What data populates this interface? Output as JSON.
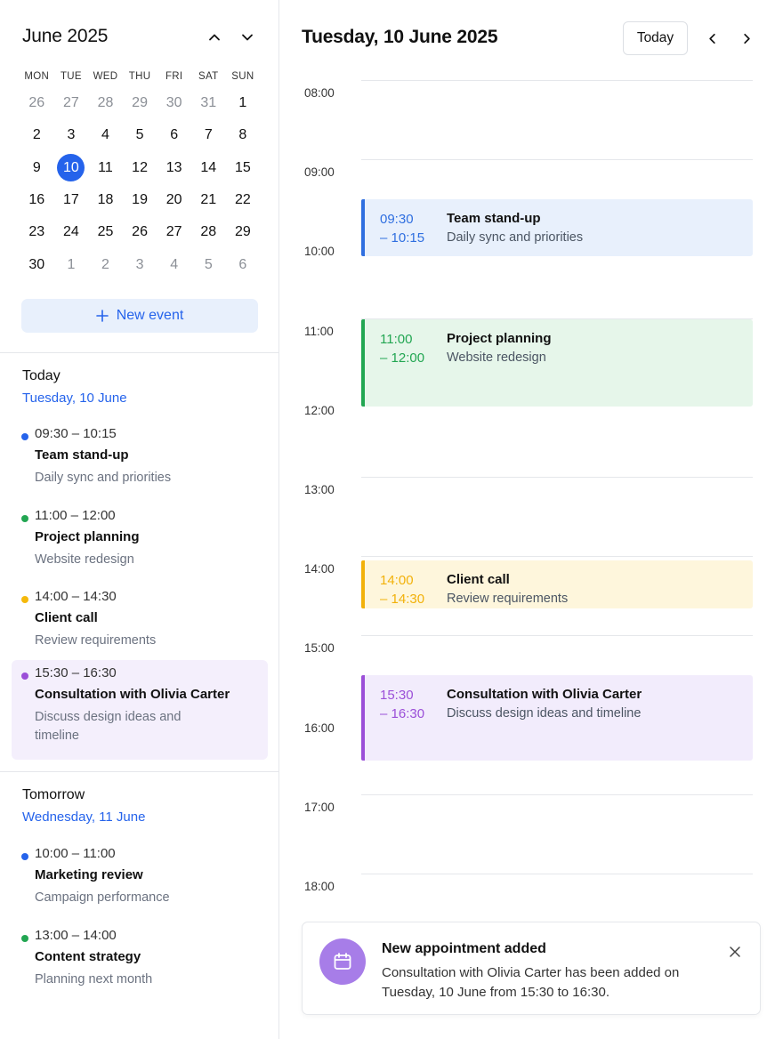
{
  "calendar": {
    "month_title": "June 2025",
    "weekdays": [
      "MON",
      "TUE",
      "WED",
      "THU",
      "FRI",
      "SAT",
      "SUN"
    ],
    "weeks": [
      [
        {
          "d": "26",
          "m": true
        },
        {
          "d": "27",
          "m": true
        },
        {
          "d": "28",
          "m": true
        },
        {
          "d": "29",
          "m": true
        },
        {
          "d": "30",
          "m": true
        },
        {
          "d": "31",
          "m": true
        },
        {
          "d": "1"
        }
      ],
      [
        {
          "d": "2"
        },
        {
          "d": "3"
        },
        {
          "d": "4"
        },
        {
          "d": "5"
        },
        {
          "d": "6"
        },
        {
          "d": "7"
        },
        {
          "d": "8"
        }
      ],
      [
        {
          "d": "9"
        },
        {
          "d": "10",
          "sel": true
        },
        {
          "d": "11"
        },
        {
          "d": "12"
        },
        {
          "d": "13"
        },
        {
          "d": "14"
        },
        {
          "d": "15"
        }
      ],
      [
        {
          "d": "16"
        },
        {
          "d": "17"
        },
        {
          "d": "18"
        },
        {
          "d": "19"
        },
        {
          "d": "20"
        },
        {
          "d": "21"
        },
        {
          "d": "22"
        }
      ],
      [
        {
          "d": "23"
        },
        {
          "d": "24"
        },
        {
          "d": "25"
        },
        {
          "d": "26"
        },
        {
          "d": "27"
        },
        {
          "d": "28"
        },
        {
          "d": "29"
        }
      ],
      [
        {
          "d": "30"
        },
        {
          "d": "1",
          "m": true
        },
        {
          "d": "2",
          "m": true
        },
        {
          "d": "3",
          "m": true
        },
        {
          "d": "4",
          "m": true
        },
        {
          "d": "5",
          "m": true
        },
        {
          "d": "6",
          "m": true
        }
      ]
    ],
    "new_event_label": "New event"
  },
  "agenda": {
    "today": {
      "title": "Today",
      "date": "Tuesday, 10 June",
      "items": [
        {
          "time": "09:30 – 10:15",
          "title": "Team stand-up",
          "desc": "Daily sync and priorities",
          "color": "#2563eb"
        },
        {
          "time": "11:00 – 12:00",
          "title": "Project planning",
          "desc": "Website redesign",
          "color": "#22a652"
        },
        {
          "time": "14:00 – 14:30",
          "title": "Client call",
          "desc": "Review requirements",
          "color": "#f5b90b"
        },
        {
          "time": "15:30 – 16:30",
          "title": "Consultation with Olivia Carter",
          "desc": "Discuss design ideas and timeline",
          "color": "#9b4fd8"
        }
      ]
    },
    "tomorrow": {
      "title": "Tomorrow",
      "date": "Wednesday, 11 June",
      "items": [
        {
          "time": "10:00 – 11:00",
          "title": "Marketing review",
          "desc": "Campaign performance",
          "color": "#2563eb"
        },
        {
          "time": "13:00 – 14:00",
          "title": "Content strategy",
          "desc": "Planning next month",
          "color": "#22a652"
        }
      ]
    }
  },
  "day_view": {
    "title": "Tuesday, 10 June 2025",
    "today_label": "Today",
    "hours": [
      "08:00",
      "09:00",
      "10:00",
      "11:00",
      "12:00",
      "13:00",
      "14:00",
      "15:00",
      "16:00",
      "17:00",
      "18:00"
    ],
    "events": [
      {
        "start": "09:30",
        "end": "– 10:15",
        "title": "Team stand-up",
        "desc": "Daily sync and priorities",
        "accent": "#2f6fe0",
        "bg": "#e8f0fc"
      },
      {
        "start": "11:00",
        "end": "– 12:00",
        "title": "Project planning",
        "desc": "Website redesign",
        "accent": "#22a652",
        "bg": "#e6f6ea"
      },
      {
        "start": "14:00",
        "end": "– 14:30",
        "title": "Client call",
        "desc": "Review requirements",
        "accent": "#f2b10a",
        "bg": "#fef6dc"
      },
      {
        "start": "15:30",
        "end": "– 16:30",
        "title": "Consultation with Olivia Carter",
        "desc": "Discuss design ideas and timeline",
        "accent": "#9b4fd8",
        "bg": "#f2ecfc"
      }
    ]
  },
  "toast": {
    "title": "New appointment added",
    "body": "Consultation with Olivia Carter has been added on Tuesday, 10 June from 15:30 to 16:30.",
    "icon_color": "#a77de8"
  }
}
